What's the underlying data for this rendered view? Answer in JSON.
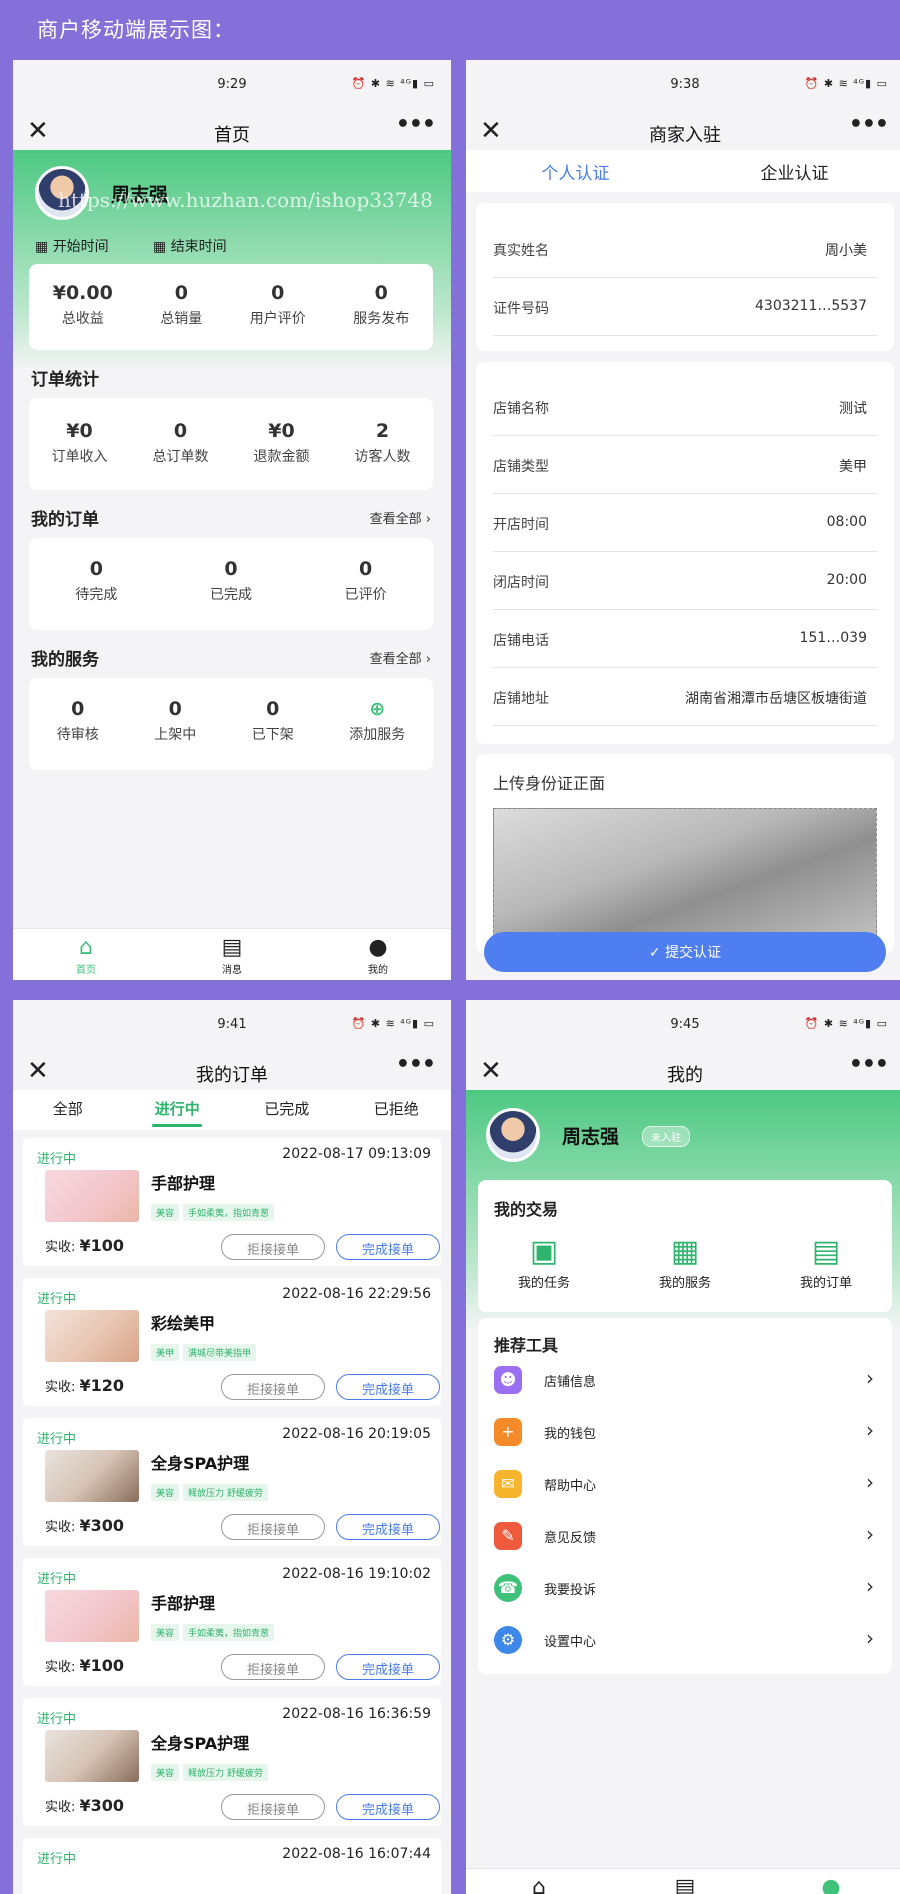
{
  "banner": "商户移动端展示图：",
  "watermark": "https://www.huzhan.com/ishop33748",
  "status_icons": "⏰ ✱ ≋ ⁴ᴳ▮ ▭",
  "more": "•••",
  "close": "✕",
  "p1": {
    "time": "9:29",
    "title": "首页",
    "user_name": "周志强",
    "start_label": "开始时间",
    "end_label": "结束时间",
    "summary": [
      {
        "value": "¥0.00",
        "label": "总收益"
      },
      {
        "value": "0",
        "label": "总销量"
      },
      {
        "value": "0",
        "label": "用户评价"
      },
      {
        "value": "0",
        "label": "服务发布"
      }
    ],
    "order_stats_title": "订单统计",
    "order_stats": [
      {
        "value": "¥0",
        "label": "订单收入"
      },
      {
        "value": "0",
        "label": "总订单数"
      },
      {
        "value": "¥0",
        "label": "退款金额"
      },
      {
        "value": "2",
        "label": "访客人数"
      }
    ],
    "my_orders_title": "我的订单",
    "view_all_orders": "查看全部",
    "my_orders": [
      {
        "value": "0",
        "label": "待完成"
      },
      {
        "value": "0",
        "label": "已完成"
      },
      {
        "value": "0",
        "label": "已评价"
      }
    ],
    "my_services_title": "我的服务",
    "view_all_services": "查看全部",
    "my_services": [
      {
        "value": "0",
        "label": "待审核"
      },
      {
        "value": "0",
        "label": "上架中"
      },
      {
        "value": "0",
        "label": "已下架"
      }
    ],
    "add_service": "添加服务",
    "tabbar": [
      "首页",
      "消息",
      "我的"
    ]
  },
  "p2": {
    "time": "9:38",
    "title": "商家入驻",
    "seg": [
      "个人认证",
      "企业认证"
    ],
    "personal": [
      {
        "k": "真实姓名",
        "v": "周小美"
      },
      {
        "k": "证件号码",
        "v": "4303211…5537"
      }
    ],
    "shop": [
      {
        "k": "店铺名称",
        "v": "测试"
      },
      {
        "k": "店铺类型",
        "v": "美甲"
      },
      {
        "k": "开店时间",
        "v": "08:00"
      },
      {
        "k": "闭店时间",
        "v": "20:00"
      },
      {
        "k": "店铺电话",
        "v": "151…039"
      },
      {
        "k": "店铺地址",
        "v": "湖南省湘潭市岳塘区板塘街道"
      }
    ],
    "upload_title": "上传身份证正面",
    "submit": "提交认证"
  },
  "p3": {
    "time": "9:41",
    "title": "我的订单",
    "tabs": [
      "全部",
      "进行中",
      "已完成",
      "已拒绝"
    ],
    "status": "进行中",
    "price_label": "实收:",
    "reject": "拒接接单",
    "complete": "完成接单",
    "orders": [
      {
        "date": "2022-08-17 09:13:09",
        "name": "手部护理",
        "tag1": "美容",
        "tag2": "手如柔荑，指如青葱",
        "price": "¥100"
      },
      {
        "date": "2022-08-16 22:29:56",
        "name": "彩绘美甲",
        "tag1": "美甲",
        "tag2": "满城尽带美指甲",
        "price": "¥120"
      },
      {
        "date": "2022-08-16 20:19:05",
        "name": "全身SPA护理",
        "tag1": "美容",
        "tag2": "释放压力 舒缓疲劳",
        "price": "¥300"
      },
      {
        "date": "2022-08-16 19:10:02",
        "name": "手部护理",
        "tag1": "美容",
        "tag2": "手如柔荑，指如青葱",
        "price": "¥100"
      },
      {
        "date": "2022-08-16 16:36:59",
        "name": "全身SPA护理",
        "tag1": "美容",
        "tag2": "释放压力 舒缓疲劳",
        "price": "¥300"
      }
    ],
    "partial_date": "2022-08-16 16:07:44"
  },
  "p4": {
    "time": "9:45",
    "title": "我的",
    "user_name": "周志强",
    "badge": "未入驻",
    "trade_title": "我的交易",
    "trade": [
      "我的任务",
      "我的服务",
      "我的订单"
    ],
    "tools_title": "推荐工具",
    "tools": [
      {
        "label": "店铺信息",
        "color": "#9b6ff2"
      },
      {
        "label": "我的钱包",
        "color": "#f58a2a"
      },
      {
        "label": "帮助中心",
        "color": "#f6b52c"
      },
      {
        "label": "意见反馈",
        "color": "#ef5a3c"
      },
      {
        "label": "我要投诉",
        "color": "#3ec27a"
      },
      {
        "label": "设置中心",
        "color": "#3d87e8"
      }
    ],
    "tabbar": [
      "首页",
      "消息",
      "我的"
    ]
  },
  "colors": {
    "green": "#3ec27a",
    "blue": "#4f7ef0",
    "bg": "#8470d9"
  }
}
